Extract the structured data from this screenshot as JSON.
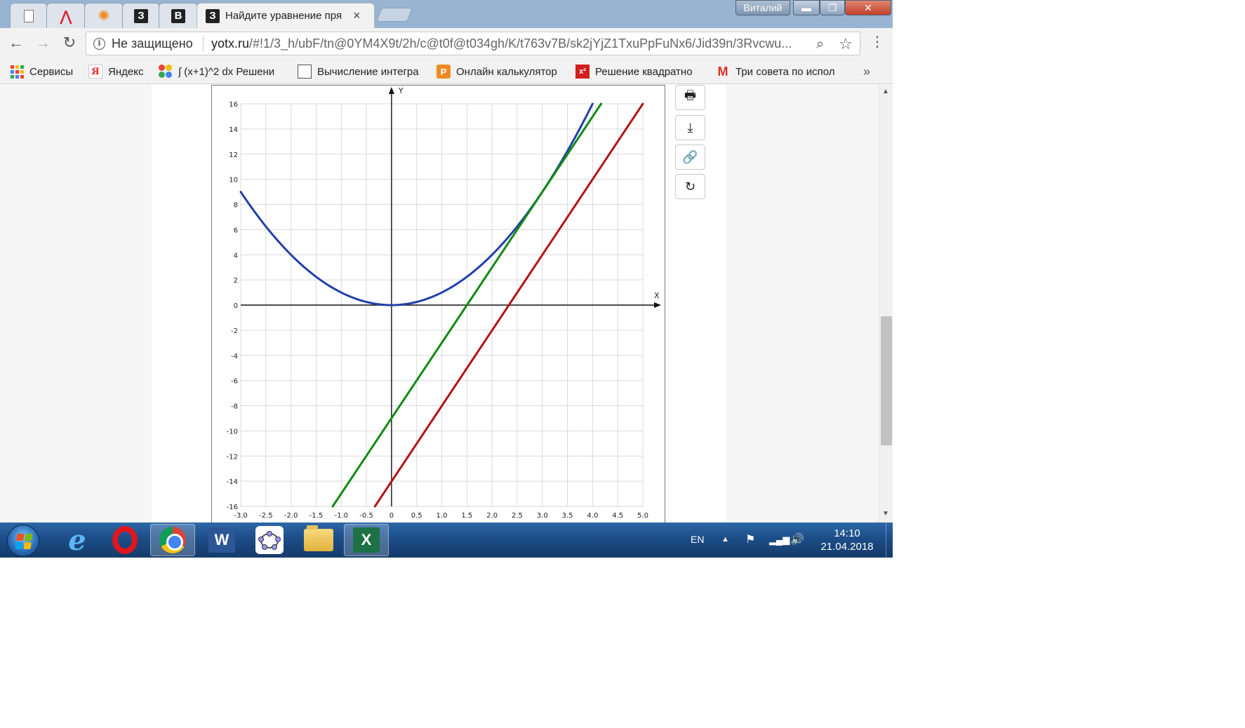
{
  "tabs": [
    {
      "icon": "document-icon",
      "title": ""
    },
    {
      "icon": "anchor-logo-icon",
      "title": ""
    },
    {
      "icon": "sun-gear-icon",
      "title": ""
    },
    {
      "icon": "z3-icon",
      "title": "",
      "glyph": "З"
    },
    {
      "icon": "b-icon",
      "title": "",
      "glyph": "B"
    },
    {
      "icon": "z3-icon",
      "title": "Найдите уравнение пря",
      "glyph": "З",
      "active": true
    }
  ],
  "window": {
    "user": "Виталий",
    "minimize": "▬",
    "maximize": "❐",
    "close": "✕"
  },
  "toolbar": {
    "back": "←",
    "forward": "→",
    "reload": "↻",
    "security_label": "Не защищено",
    "url_domain": "yotx.ru",
    "url_path": "/#!1/3_h/ubF/tn@0YM4X9t/2h/c@t0f@t034gh/K/t763v7B/sk2jYjZ1TxuPpFuNx6/Jid39n/3Rvcwu..."
  },
  "bookmarks": [
    {
      "icon": "apps-grid-icon",
      "label": "Сервисы"
    },
    {
      "icon": "yandex-icon",
      "label": "Яндекс"
    },
    {
      "icon": "clover-icon",
      "label": "∫ (x+1)^2 dx Решени"
    },
    {
      "icon": "box-icon",
      "label": "Вычисление интегра"
    },
    {
      "icon": "calculator-icon",
      "label": "Онлайн калькулятор"
    },
    {
      "icon": "quadratic-icon",
      "label": "Решение квадратно"
    },
    {
      "icon": "gmail-icon",
      "label": "Три совета по испол"
    }
  ],
  "bookmarks_more": "»",
  "tools": [
    {
      "name": "print-icon",
      "glyph": "🖶"
    },
    {
      "name": "download-icon",
      "glyph": "⤓"
    },
    {
      "name": "link-icon",
      "glyph": "🔗"
    },
    {
      "name": "share-icon",
      "glyph": "↻"
    }
  ],
  "chart_data": {
    "type": "line",
    "title": "",
    "xlabel": "X",
    "ylabel": "Y",
    "xlim": [
      -3.0,
      5.0
    ],
    "ylim": [
      -16,
      16
    ],
    "grid": true,
    "xticks": [
      "-3.0",
      "-2.5",
      "-2.0",
      "-1.5",
      "-1.0",
      "-0.5",
      "0",
      "0.5",
      "1.0",
      "1.5",
      "2.0",
      "2.5",
      "3.0",
      "3.5",
      "4.0",
      "4.5",
      "5.0"
    ],
    "yticks": [
      "16",
      "14",
      "12",
      "10",
      "8",
      "6",
      "4",
      "2",
      "0",
      "-2",
      "-4",
      "-6",
      "-8",
      "-10",
      "-12",
      "-14",
      "-16"
    ],
    "series": [
      {
        "color": "#2240a8",
        "x": [
          -3.0,
          -2.5,
          -2.0,
          -1.5,
          -1.0,
          -0.5,
          0,
          0.5,
          1.0,
          1.5,
          2.0,
          2.5,
          3.0,
          3.5,
          4.0
        ],
        "y": [
          9.0,
          6.25,
          4.0,
          2.25,
          1.0,
          0.25,
          0,
          0.25,
          1.0,
          2.25,
          4.0,
          6.25,
          9.0,
          12.25,
          16.0
        ]
      },
      {
        "color": "#138a13",
        "x": [
          -1.17,
          4.17
        ],
        "y": [
          -16,
          16
        ]
      },
      {
        "color": "#b01515",
        "x": [
          -0.33,
          5.0
        ],
        "y": [
          -16,
          16
        ]
      }
    ]
  },
  "taskbar": {
    "lang": "EN",
    "time": "14:10",
    "date": "21.04.2018",
    "apps": [
      "internet-explorer-icon",
      "opera-icon",
      "chrome-icon",
      "word-icon",
      "geogebra-icon",
      "explorer-folder-icon",
      "excel-icon"
    ],
    "word_glyph": "W",
    "excel_glyph": "X"
  },
  "colors": {
    "tabstrip": "#99b4d1",
    "taskbar": "#1c4d87",
    "parabola": "#2240a8",
    "tangent": "#138a13",
    "parallel": "#b01515"
  }
}
